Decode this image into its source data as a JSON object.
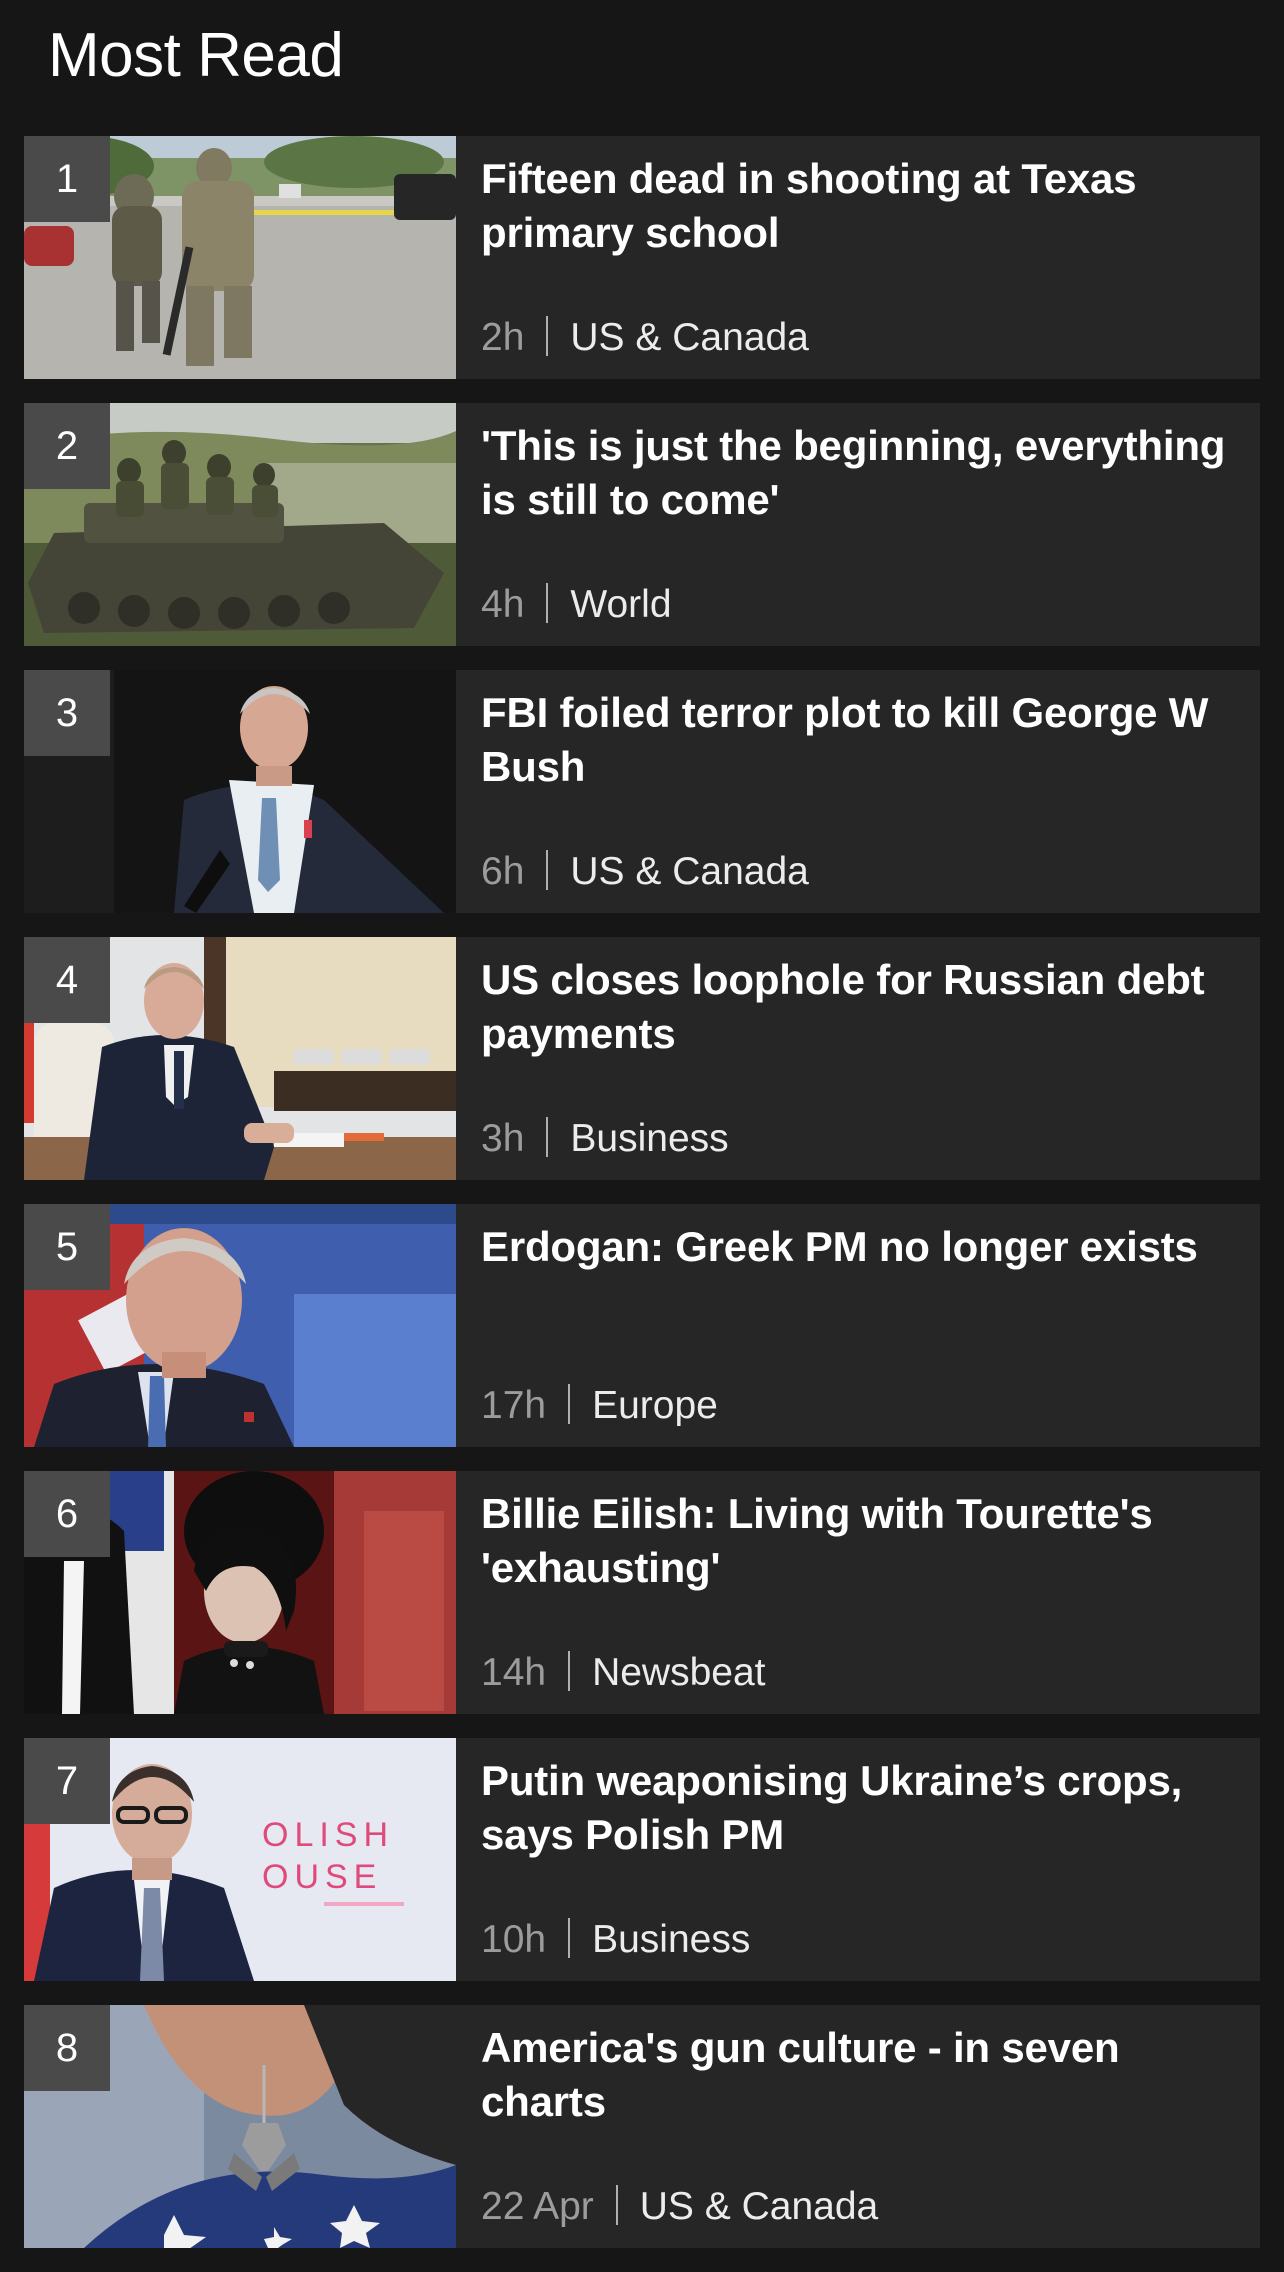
{
  "section": {
    "title": "Most Read"
  },
  "articles": [
    {
      "rank": "1",
      "headline": "Fifteen dead in shooting at Texas primary school",
      "time": "2h",
      "category": "US & Canada",
      "image": "texas-police-photo"
    },
    {
      "rank": "2",
      "headline": "'This is just the beginning, everything is still to come'",
      "time": "4h",
      "category": "World",
      "image": "tank-soldiers-photo"
    },
    {
      "rank": "3",
      "headline": "FBI foiled terror plot to kill George W Bush",
      "time": "6h",
      "category": "US & Canada",
      "image": "bush-portrait-photo"
    },
    {
      "rank": "4",
      "headline": "US closes loophole for Russian debt payments",
      "time": "3h",
      "category": "Business",
      "image": "putin-desk-photo"
    },
    {
      "rank": "5",
      "headline": "Erdogan: Greek PM no longer exists",
      "time": "17h",
      "category": "Europe",
      "image": "erdogan-portrait-photo"
    },
    {
      "rank": "6",
      "headline": "Billie Eilish: Living with Tourette's 'exhausting'",
      "time": "14h",
      "category": "Newsbeat",
      "image": "eilish-portrait-photo"
    },
    {
      "rank": "7",
      "headline": "Putin weaponising Ukraine’s crops, says Polish PM",
      "time": "10h",
      "category": "Business",
      "image": "polish-pm-photo",
      "image_caption": "OLISH OUSE"
    },
    {
      "rank": "8",
      "headline": "America's gun culture - in seven charts",
      "time": "22 Apr",
      "category": "US & Canada",
      "image": "gun-earring-photo"
    }
  ]
}
